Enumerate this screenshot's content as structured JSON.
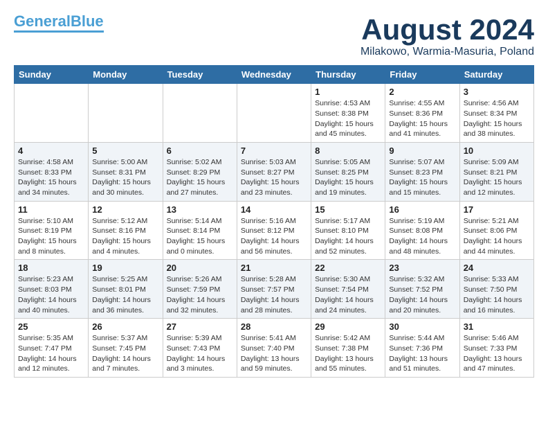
{
  "header": {
    "logo_line1": "General",
    "logo_line2": "Blue",
    "title": "August 2024",
    "subtitle": "Milakowo, Warmia-Masuria, Poland"
  },
  "weekdays": [
    "Sunday",
    "Monday",
    "Tuesday",
    "Wednesday",
    "Thursday",
    "Friday",
    "Saturday"
  ],
  "weeks": [
    [
      {
        "day": "",
        "info": ""
      },
      {
        "day": "",
        "info": ""
      },
      {
        "day": "",
        "info": ""
      },
      {
        "day": "",
        "info": ""
      },
      {
        "day": "1",
        "info": "Sunrise: 4:53 AM\nSunset: 8:38 PM\nDaylight: 15 hours\nand 45 minutes."
      },
      {
        "day": "2",
        "info": "Sunrise: 4:55 AM\nSunset: 8:36 PM\nDaylight: 15 hours\nand 41 minutes."
      },
      {
        "day": "3",
        "info": "Sunrise: 4:56 AM\nSunset: 8:34 PM\nDaylight: 15 hours\nand 38 minutes."
      }
    ],
    [
      {
        "day": "4",
        "info": "Sunrise: 4:58 AM\nSunset: 8:33 PM\nDaylight: 15 hours\nand 34 minutes."
      },
      {
        "day": "5",
        "info": "Sunrise: 5:00 AM\nSunset: 8:31 PM\nDaylight: 15 hours\nand 30 minutes."
      },
      {
        "day": "6",
        "info": "Sunrise: 5:02 AM\nSunset: 8:29 PM\nDaylight: 15 hours\nand 27 minutes."
      },
      {
        "day": "7",
        "info": "Sunrise: 5:03 AM\nSunset: 8:27 PM\nDaylight: 15 hours\nand 23 minutes."
      },
      {
        "day": "8",
        "info": "Sunrise: 5:05 AM\nSunset: 8:25 PM\nDaylight: 15 hours\nand 19 minutes."
      },
      {
        "day": "9",
        "info": "Sunrise: 5:07 AM\nSunset: 8:23 PM\nDaylight: 15 hours\nand 15 minutes."
      },
      {
        "day": "10",
        "info": "Sunrise: 5:09 AM\nSunset: 8:21 PM\nDaylight: 15 hours\nand 12 minutes."
      }
    ],
    [
      {
        "day": "11",
        "info": "Sunrise: 5:10 AM\nSunset: 8:19 PM\nDaylight: 15 hours\nand 8 minutes."
      },
      {
        "day": "12",
        "info": "Sunrise: 5:12 AM\nSunset: 8:16 PM\nDaylight: 15 hours\nand 4 minutes."
      },
      {
        "day": "13",
        "info": "Sunrise: 5:14 AM\nSunset: 8:14 PM\nDaylight: 15 hours\nand 0 minutes."
      },
      {
        "day": "14",
        "info": "Sunrise: 5:16 AM\nSunset: 8:12 PM\nDaylight: 14 hours\nand 56 minutes."
      },
      {
        "day": "15",
        "info": "Sunrise: 5:17 AM\nSunset: 8:10 PM\nDaylight: 14 hours\nand 52 minutes."
      },
      {
        "day": "16",
        "info": "Sunrise: 5:19 AM\nSunset: 8:08 PM\nDaylight: 14 hours\nand 48 minutes."
      },
      {
        "day": "17",
        "info": "Sunrise: 5:21 AM\nSunset: 8:06 PM\nDaylight: 14 hours\nand 44 minutes."
      }
    ],
    [
      {
        "day": "18",
        "info": "Sunrise: 5:23 AM\nSunset: 8:03 PM\nDaylight: 14 hours\nand 40 minutes."
      },
      {
        "day": "19",
        "info": "Sunrise: 5:25 AM\nSunset: 8:01 PM\nDaylight: 14 hours\nand 36 minutes."
      },
      {
        "day": "20",
        "info": "Sunrise: 5:26 AM\nSunset: 7:59 PM\nDaylight: 14 hours\nand 32 minutes."
      },
      {
        "day": "21",
        "info": "Sunrise: 5:28 AM\nSunset: 7:57 PM\nDaylight: 14 hours\nand 28 minutes."
      },
      {
        "day": "22",
        "info": "Sunrise: 5:30 AM\nSunset: 7:54 PM\nDaylight: 14 hours\nand 24 minutes."
      },
      {
        "day": "23",
        "info": "Sunrise: 5:32 AM\nSunset: 7:52 PM\nDaylight: 14 hours\nand 20 minutes."
      },
      {
        "day": "24",
        "info": "Sunrise: 5:33 AM\nSunset: 7:50 PM\nDaylight: 14 hours\nand 16 minutes."
      }
    ],
    [
      {
        "day": "25",
        "info": "Sunrise: 5:35 AM\nSunset: 7:47 PM\nDaylight: 14 hours\nand 12 minutes."
      },
      {
        "day": "26",
        "info": "Sunrise: 5:37 AM\nSunset: 7:45 PM\nDaylight: 14 hours\nand 7 minutes."
      },
      {
        "day": "27",
        "info": "Sunrise: 5:39 AM\nSunset: 7:43 PM\nDaylight: 14 hours\nand 3 minutes."
      },
      {
        "day": "28",
        "info": "Sunrise: 5:41 AM\nSunset: 7:40 PM\nDaylight: 13 hours\nand 59 minutes."
      },
      {
        "day": "29",
        "info": "Sunrise: 5:42 AM\nSunset: 7:38 PM\nDaylight: 13 hours\nand 55 minutes."
      },
      {
        "day": "30",
        "info": "Sunrise: 5:44 AM\nSunset: 7:36 PM\nDaylight: 13 hours\nand 51 minutes."
      },
      {
        "day": "31",
        "info": "Sunrise: 5:46 AM\nSunset: 7:33 PM\nDaylight: 13 hours\nand 47 minutes."
      }
    ]
  ]
}
